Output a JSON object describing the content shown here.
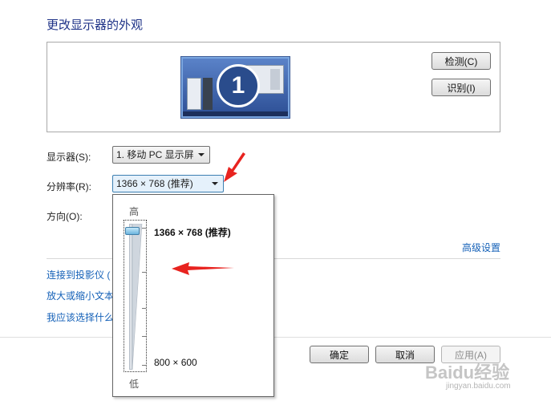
{
  "page": {
    "title": "更改显示器的外观"
  },
  "preview": {
    "monitor_number": "1",
    "detect_label": "检测(C)",
    "identify_label": "识别(I)"
  },
  "form": {
    "display_label": "显示器(S):",
    "display_value": "1. 移动 PC 显示屏",
    "resolution_label": "分辨率(R):",
    "resolution_value": "1366 × 768 (推荐)",
    "orientation_label": "方向(O):",
    "advanced_link": "高级设置"
  },
  "links": {
    "projector": "连接到投影仪 (",
    "text_size": "放大或缩小文本",
    "which_settings": "我应该选择什么"
  },
  "resolution_popup": {
    "high_label": "高",
    "low_label": "低",
    "top_resolution": "1366 × 768 (推荐)",
    "bottom_resolution": "800 × 600",
    "slider_level": 1.0
  },
  "footer": {
    "ok_label": "确定",
    "cancel_label": "取消",
    "apply_label": "应用(A)"
  },
  "watermark": {
    "text": "Baidu经验",
    "sub": "jingyan.baidu.com"
  },
  "colors": {
    "title": "#1e3287",
    "link": "#1561b8",
    "annotation_arrow": "#e8231f"
  }
}
